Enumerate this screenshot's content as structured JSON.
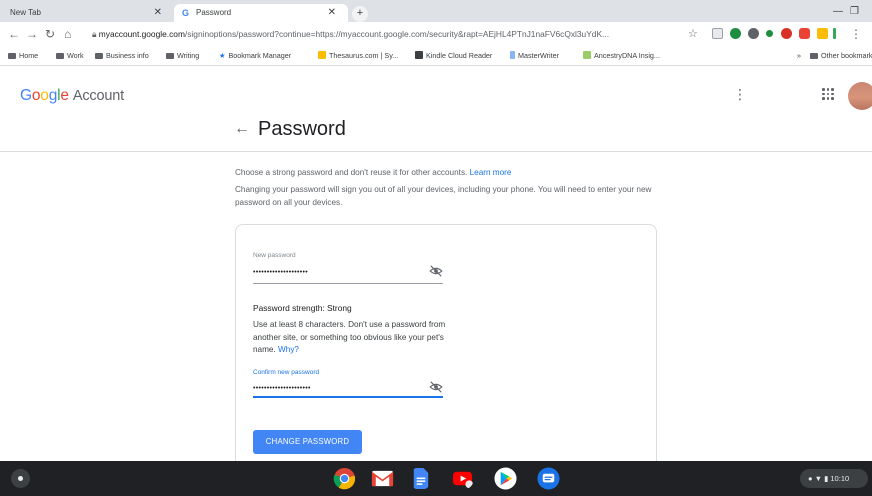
{
  "browser": {
    "tabs": [
      {
        "title": "New Tab",
        "active": false
      },
      {
        "title": "Password",
        "active": true
      }
    ],
    "new_tab_glyph": "+",
    "url_host": "myaccount.google.com",
    "url_rest": "/signinoptions/password?continue=https://myaccount.google.com/security&rapt=AEjHL4PTnJ1naFV6cQxl3uYdK...",
    "bookmarks": [
      {
        "label": "Home",
        "icon": "folder-icon"
      },
      {
        "label": "Work",
        "icon": "folder-icon"
      },
      {
        "label": "Business info",
        "icon": "folder-icon"
      },
      {
        "label": "Writing",
        "icon": "folder-icon"
      },
      {
        "label": "Bookmark Manager",
        "icon": "star-icon"
      },
      {
        "label": "Thesaurus.com | Sy...",
        "icon": "site-icon"
      },
      {
        "label": "Kindle Cloud Reader",
        "icon": "site-icon"
      },
      {
        "label": "MasterWriter",
        "icon": "site-icon"
      },
      {
        "label": "AncestryDNA Insig...",
        "icon": "site-icon"
      }
    ],
    "bookmarks_overflow": "»",
    "other_bookmarks": "Other bookmarks"
  },
  "header": {
    "logo_google": "Google",
    "logo_account": "Account"
  },
  "page": {
    "title": "Password",
    "intro": "Choose a strong password and don't reuse it for other accounts.",
    "learn_more": "Learn more",
    "warning": "Changing your password will sign you out of all your devices, including your phone. You will need to enter your new password on all your devices."
  },
  "form": {
    "new_password_label": "New password",
    "new_password_value": "••••••••••••••••••••",
    "strength_label": "Password strength:",
    "strength_value": "Strong",
    "hint": "Use at least 8 characters. Don't use a password from another site, or something too obvious like your pet's name.",
    "why": "Why?",
    "confirm_label": "Confirm new password",
    "confirm_value": "•••••••••••••••••••••",
    "submit_label": "CHANGE PASSWORD"
  },
  "shelf": {
    "apps": [
      "chrome-icon",
      "gmail-icon",
      "docs-icon",
      "youtube-icon",
      "play-store-icon",
      "messages-icon"
    ],
    "time": "10:10"
  },
  "colors": {
    "accent": "#1a73e8",
    "button": "#4285f4",
    "shelf": "#202124"
  }
}
